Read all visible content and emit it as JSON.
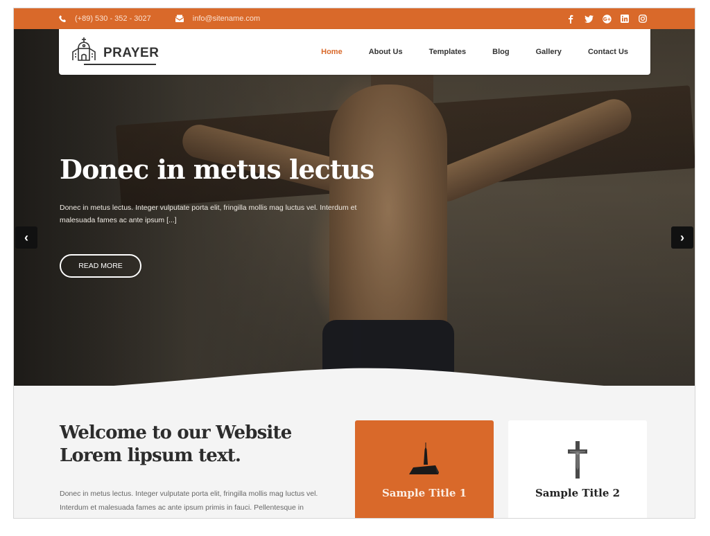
{
  "topbar": {
    "phone": "(+89) 530 - 352 - 3027",
    "email": "info@sitename.com",
    "social": [
      {
        "name": "facebook",
        "glyph": "f"
      },
      {
        "name": "twitter",
        "glyph": "t"
      },
      {
        "name": "google-plus",
        "glyph": "G+"
      },
      {
        "name": "linkedin",
        "glyph": "in"
      },
      {
        "name": "instagram",
        "glyph": "ig"
      }
    ]
  },
  "brand": {
    "name": "PRAYER",
    "accent_color": "#d9692a"
  },
  "nav": {
    "items": [
      {
        "label": "Home",
        "active": true
      },
      {
        "label": "About Us",
        "active": false
      },
      {
        "label": "Templates",
        "active": false
      },
      {
        "label": "Blog",
        "active": false
      },
      {
        "label": "Gallery",
        "active": false
      },
      {
        "label": "Contact Us",
        "active": false
      }
    ]
  },
  "hero": {
    "title": "Donec in metus lectus",
    "text": "Donec in metus lectus. Integer vulputate porta elit, fringilla mollis mag luctus vel. Interdum et malesuada fames ac ante ipsum [...]",
    "button": "READ MORE",
    "prev_arrow": "‹",
    "next_arrow": "›"
  },
  "welcome": {
    "title_line1": "Welcome to our Website",
    "title_line2": "Lorem lipsum text.",
    "text": "Donec in metus lectus. Integer vulputate porta elit, fringilla mollis mag luctus vel. Interdum et malesuada fames ac ante ipsum primis in fauci. Pellentesque in"
  },
  "cards": [
    {
      "title": "Sample Title 1",
      "icon": "church-icon"
    },
    {
      "title": "Sample Title 2",
      "icon": "crucifix-icon"
    }
  ]
}
